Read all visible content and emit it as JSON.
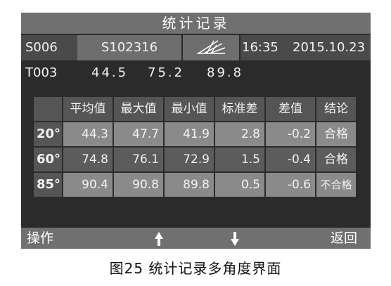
{
  "screen": {
    "title": "统计记录",
    "info": {
      "sample_id": "S006",
      "standard_id": "S102316",
      "time": "16:35",
      "date": "2015.10.23"
    },
    "row2": {
      "id": "T003",
      "v1": "44.5",
      "v2": "75.2",
      "v3": "89.8"
    },
    "table": {
      "headers": [
        "平均值",
        "最大值",
        "最小值",
        "标准差",
        "差值",
        "结论"
      ],
      "rows": [
        {
          "angle": "20°",
          "cells": [
            "44.3",
            "47.7",
            "41.9",
            "2.8",
            "-0.2",
            "合格"
          ]
        },
        {
          "angle": "60°",
          "cells": [
            "74.8",
            "76.1",
            "72.9",
            "1.5",
            "-0.4",
            "合格"
          ]
        },
        {
          "angle": "85°",
          "cells": [
            "90.4",
            "90.8",
            "89.8",
            "0.5",
            "-0.6",
            "不合格"
          ]
        }
      ]
    },
    "footer": {
      "operate": "操作",
      "back": "返回"
    }
  },
  "caption": "图25 统计记录多角度界面",
  "icons": {
    "up": "up-arrow-icon",
    "down": "down-arrow-icon",
    "measure": "gloss-angle-icon"
  }
}
